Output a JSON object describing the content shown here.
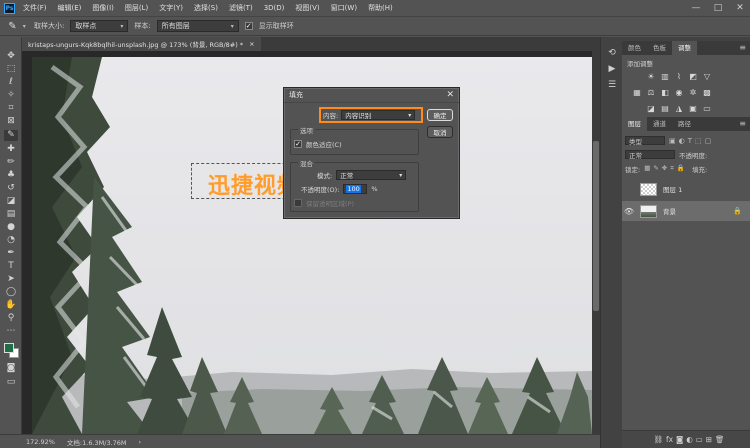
{
  "app": {
    "logo": "Ps",
    "menu": [
      "文件(F)",
      "编辑(E)",
      "图像(I)",
      "图层(L)",
      "文字(Y)",
      "选择(S)",
      "滤镜(T)",
      "3D(D)",
      "视图(V)",
      "窗口(W)",
      "帮助(H)"
    ],
    "window_controls": [
      "—",
      "□",
      "✕"
    ]
  },
  "options_bar": {
    "tool_icon": "eyedropper-icon",
    "sample_size_label": "取样大小:",
    "sample_size_value": "取样点",
    "sample_label": "样本:",
    "sample_value": "所有图层",
    "show_ring_label": "显示取样环",
    "show_ring_checked": true
  },
  "document": {
    "tab_title": "kristaps-ungurs-Kqk8bqlhil-unsplash.jpg @ 173% (背景, RGB/8#) *",
    "tab_close": "×",
    "overlay_text": "迅捷视频"
  },
  "status_bar": {
    "zoom": "172.92%",
    "doc_info": "文档:1.6.3M/3.76M",
    "arrow": "›"
  },
  "right_panels": {
    "top_tabs": [
      "颜色",
      "色板",
      "调整"
    ],
    "active_top_tab": "调整",
    "adjustments_label": "添加调整",
    "layer_tabs": [
      "图层",
      "通道",
      "路径"
    ],
    "active_layer_tab": "图层",
    "filter_kind": "类型",
    "blend_mode": "正常",
    "opacity_label": "不透明度:",
    "lock_label": "锁定:",
    "fill_label": "填充:",
    "layers": [
      {
        "name": "图层 1",
        "visible": false,
        "selected": false,
        "locked": false,
        "thumb": "transparent"
      },
      {
        "name": "背景",
        "visible": true,
        "selected": true,
        "locked": true,
        "thumb": "photo"
      }
    ],
    "footer_icons": [
      "link-icon",
      "fx-icon",
      "mask-icon",
      "adjustment-icon",
      "folder-icon",
      "new-layer-icon",
      "trash-icon"
    ]
  },
  "fill_dialog": {
    "title": "填充",
    "close": "✕",
    "content_label": "内容:",
    "content_value": "内容识别",
    "ok_label": "确定",
    "cancel_label": "取消",
    "options_title": "选项",
    "color_adapt_label": "颜色适应(C)",
    "color_adapt_checked": true,
    "blending_title": "混合",
    "mode_label": "模式:",
    "mode_value": "正常",
    "opacity_label": "不透明度(O):",
    "opacity_value": "100",
    "opacity_unit": "%",
    "preserve_label": "保留透明区域(P)",
    "preserve_checked": false
  },
  "colors": {
    "accent_orange": "#ff8c1a",
    "overlay_text_color": "#ff9c2a",
    "selection_blue": "#1473e6",
    "foreground_color": "#1f6e4a",
    "background_color": "#ffffff"
  }
}
